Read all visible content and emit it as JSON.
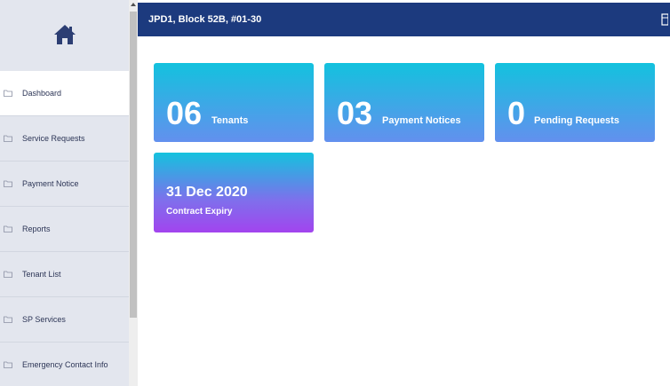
{
  "sidebar": {
    "logo_icon": "home-icon",
    "items": [
      {
        "label": "Dashboard",
        "icon": "folder-icon"
      },
      {
        "label": "Service Requests",
        "icon": "folder-icon"
      },
      {
        "label": "Payment Notice",
        "icon": "folder-icon"
      },
      {
        "label": "Reports",
        "icon": "folder-icon"
      },
      {
        "label": "Tenant List",
        "icon": "folder-icon"
      },
      {
        "label": "SP Services",
        "icon": "folder-icon"
      },
      {
        "label": "Emergency Contact Info",
        "icon": "folder-icon"
      }
    ],
    "active_item": "Dashboard"
  },
  "header": {
    "title": "JPD1, Block 52B, #01-30",
    "icon": "document-icon"
  },
  "cards": {
    "tenants": {
      "count": "06",
      "caption": "Tenants"
    },
    "payment_notices": {
      "count": "03",
      "caption": "Payment Notices"
    },
    "pending_requests": {
      "count": "0",
      "caption": "Pending Requests"
    },
    "contract_expiry": {
      "date": "31 Dec 2020",
      "caption": "Contract Expiry"
    }
  },
  "colors": {
    "header_bg": "#1c3a7e",
    "sidebar_bg": "#e3e6ee",
    "card_gradient_top": "#13c2de",
    "card_gradient_bottom": "#6390ee",
    "expiry_gradient_bottom": "#a244ee"
  }
}
